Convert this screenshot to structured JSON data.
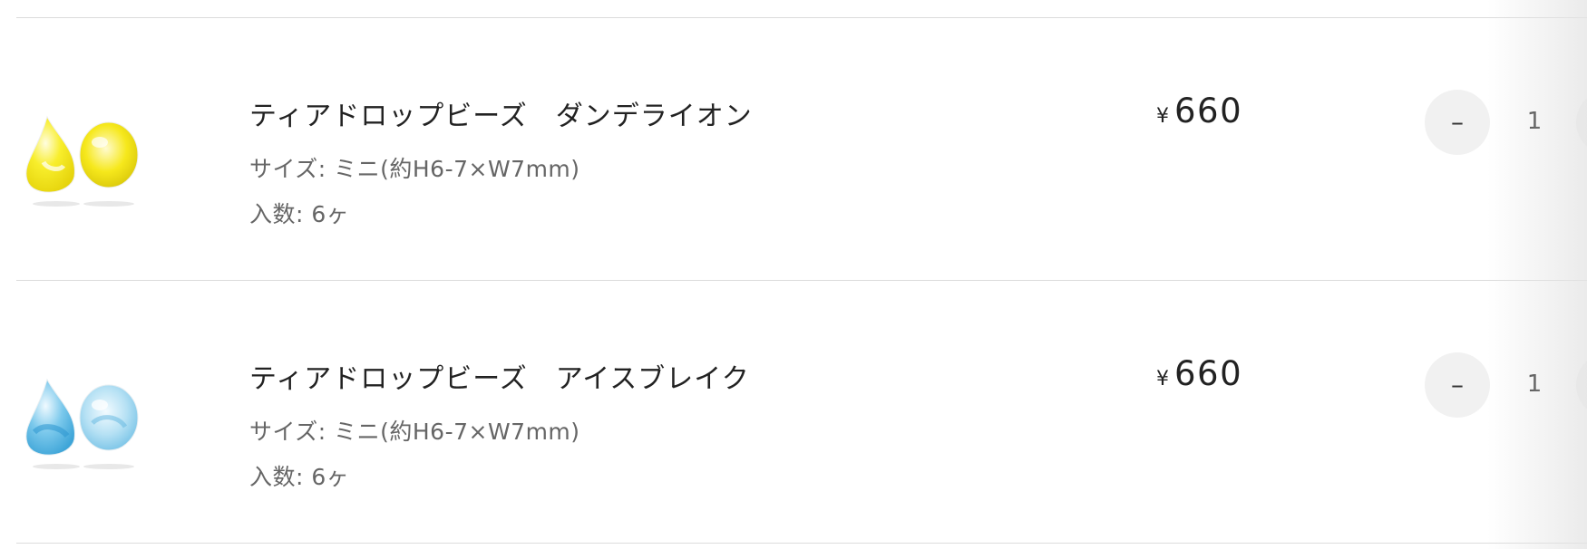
{
  "cart": {
    "items": [
      {
        "name": "ティアドロップビーズ　ダンデライオン",
        "size_option": "サイズ: ミニ(約H6-7×W7mm)",
        "count_option": "入数: 6ヶ",
        "price_currency": "¥",
        "price_amount": "660",
        "quantity": "1",
        "minus_label": "–",
        "bead_colors": {
          "primary": "#f5ea1e",
          "light": "#fcf8b0",
          "shade": "#e3d20a"
        }
      },
      {
        "name": "ティアドロップビーズ　アイスブレイク",
        "size_option": "サイズ: ミニ(約H6-7×W7mm)",
        "count_option": "入数: 6ヶ",
        "price_currency": "¥",
        "price_amount": "660",
        "quantity": "1",
        "minus_label": "–",
        "bead_colors": {
          "primary": "#6ec3ea",
          "light": "#d8eef9",
          "shade": "#3fa6d9"
        }
      }
    ]
  }
}
